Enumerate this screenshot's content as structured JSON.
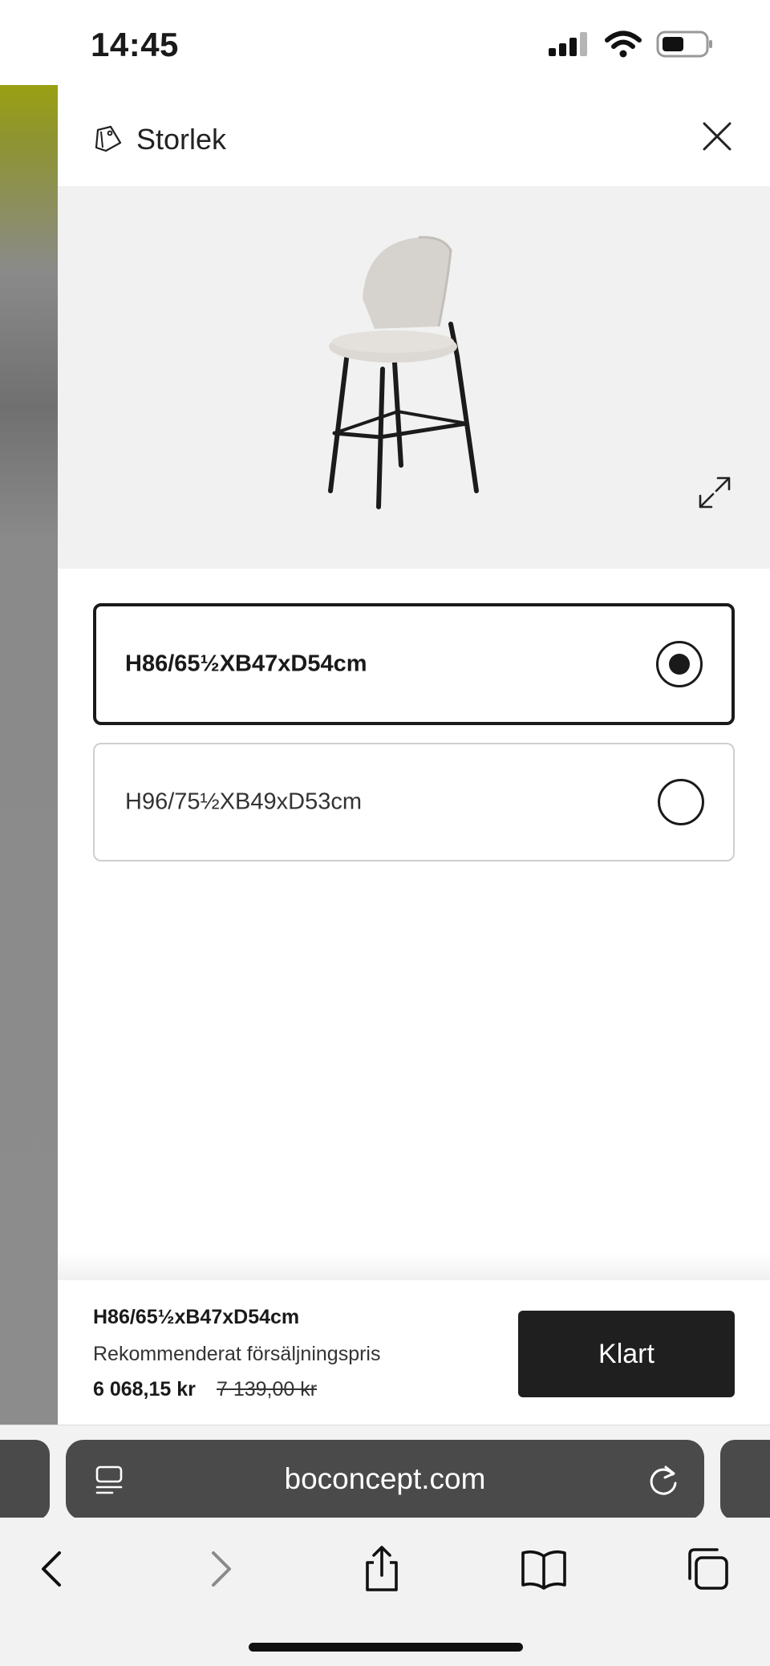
{
  "status_bar": {
    "time": "14:45"
  },
  "drawer": {
    "title": "Storlek",
    "options": [
      {
        "label": "H86/65½XB47xD54cm",
        "selected": true
      },
      {
        "label": "H96/75½XB49xD53cm",
        "selected": false
      }
    ]
  },
  "footer": {
    "selected_size": "H86/65½xB47xD54cm",
    "recommended_label": "Rekommenderat försäljningspris",
    "price": "6 068,15 kr",
    "old_price": "7 139,00 kr",
    "done_label": "Klart"
  },
  "browser": {
    "url": "boconcept.com"
  },
  "colors": {
    "accent": "#1f1f1f",
    "image_bg": "#f1f1f1",
    "browser_pill": "#4a4a4a"
  },
  "icons": [
    "size-tag-icon",
    "close-icon",
    "expand-icon",
    "page-menu-icon",
    "reload-icon",
    "back-icon",
    "forward-icon",
    "share-icon",
    "bookmarks-icon",
    "tabs-icon"
  ]
}
